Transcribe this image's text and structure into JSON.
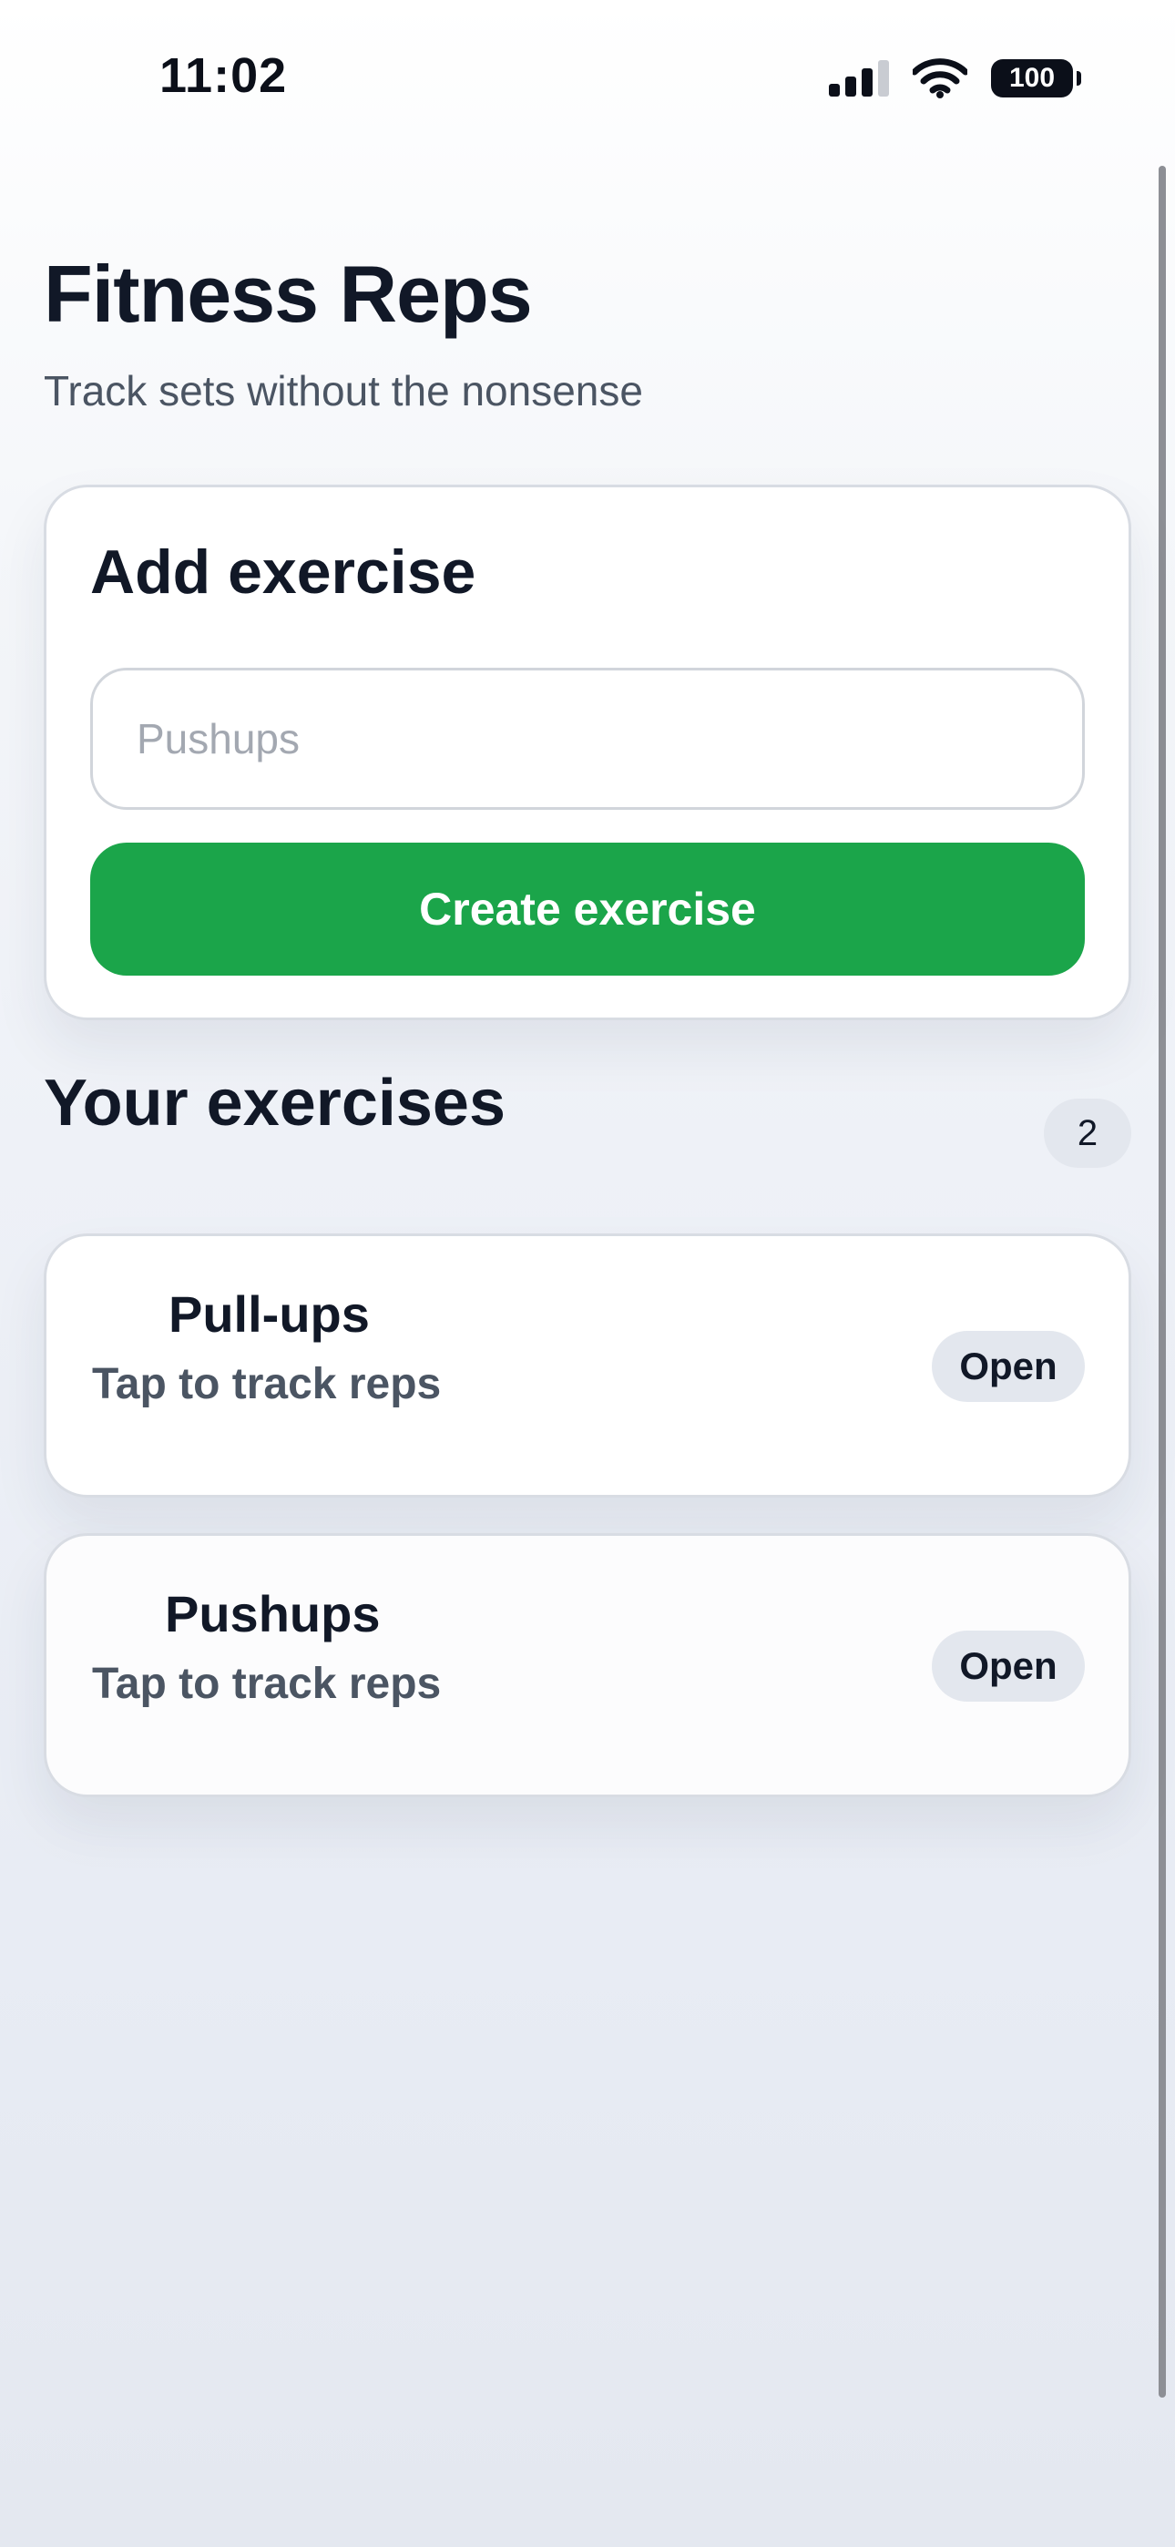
{
  "status_bar": {
    "time": "11:02",
    "battery_level": "100",
    "icons": [
      "cellular-signal-icon",
      "wifi-icon",
      "battery-icon"
    ]
  },
  "header": {
    "title": "Fitness Reps",
    "subtitle": "Track sets without the nonsense"
  },
  "add_exercise": {
    "title": "Add exercise",
    "input_value": "",
    "input_placeholder": "Pushups",
    "button_label": "Create exercise"
  },
  "exercises": {
    "title": "Your exercises",
    "count": "2",
    "items": [
      {
        "name": "Pull-ups",
        "hint": "Tap to track reps",
        "action_label": "Open"
      },
      {
        "name": "Pushups",
        "hint": "Tap to track reps",
        "action_label": "Open"
      }
    ]
  },
  "colors": {
    "accent": "#1ba54a",
    "text_primary": "#111827",
    "text_secondary": "#4b5563",
    "badge_bg": "#e3e7ee"
  }
}
